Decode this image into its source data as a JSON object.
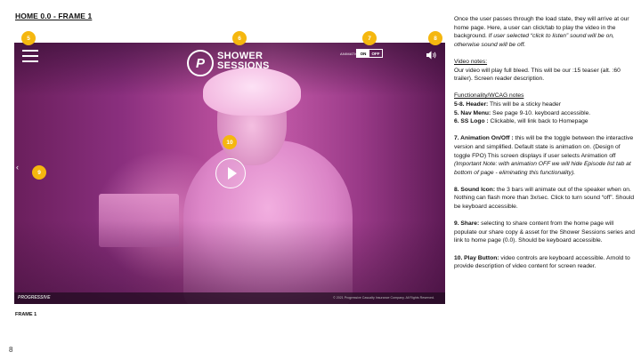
{
  "header": {
    "title": "HOME 0.0 - FRAME 1"
  },
  "mockup": {
    "logo_letter": "P",
    "logo_line1": "SHOWER",
    "logo_line2": "SESSIONS",
    "animation_label": "ANIMATION",
    "toggle_on": "ON",
    "toggle_off": "OFF",
    "brand": "PROGRESSIVE",
    "copyright": "© 2021 Progressive Casualty Insurance Company. All Rights Reserved.",
    "frame_label": "FRAME 1",
    "markers": [
      "5",
      "6",
      "7",
      "8",
      "9",
      "10"
    ]
  },
  "page_number": "8",
  "notes": {
    "intro_plain": "Once the user passes through the load state, they will arrive at our home page. Here, a user can click/tab to play the video in the background. ",
    "intro_italic": "If user selected “click to listen” sound will be on, otherwise sound will be off.",
    "video_heading": "Video notes:",
    "video_body": "Our video will play full bleed. This will be our :15 teaser (alt. :60 trailer). Screen reader description.",
    "func_heading": "Functionality/WCAG notes",
    "item_5_8_label": "5-8. Header:",
    "item_5_8_text": " This will be a sticky header",
    "item_5_label": "5. Nav Menu:",
    "item_5_text": " See page 9-10. keyboard accessible.",
    "item_6_label": "6. SS Logo :",
    "item_6_text": " Clickable, will link back to Homepage",
    "item_7_label": "7. Animation On/Off :",
    "item_7_text": " this will be the toggle between the interactive version and simplified. Default state is animation on. (Design of toggle FPO) This screen displays if user selects Animation off ",
    "item_7_italic": "(Important Note: with animation OFF we will hide Episode list tab at bottom of page  - eliminating this functionality).",
    "item_8_label": "8. Sound Icon:",
    "item_8_text": " the 3 bars will animate out of the speaker when on. Nothing can flash more than 3x/sec. Click to turn sound “off”. Should be keyboard accessible.",
    "item_9_label": "9. Share:",
    "item_9_text": " selecting to share content from the home page will populate our share copy & asset for the Shower Sessions series and link to home page (0.0). Should be keyboard accessible.",
    "item_10_label": "10. Play Button:",
    "item_10_text": " video controls are keyboard accessible. Arnold to provide description of video content for screen reader."
  },
  "colors": {
    "marker": "#f5b70f",
    "video_tint": "#b24a98"
  }
}
